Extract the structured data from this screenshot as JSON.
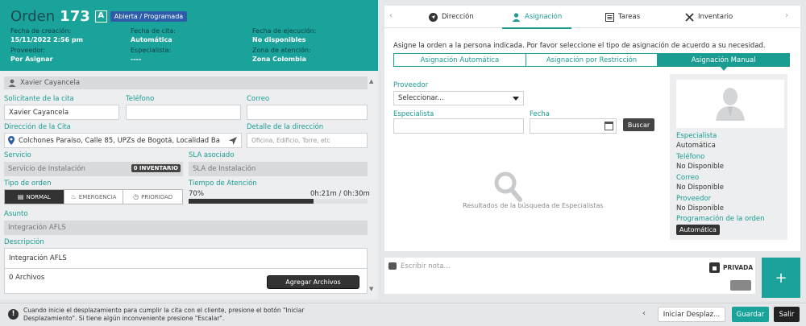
{
  "order": {
    "word": "Orden",
    "number": "173",
    "letter": "A",
    "status": "Abierta / Programada",
    "fields": [
      {
        "label": "Fecha de creación:",
        "value": "15/11/2022 2:56 pm"
      },
      {
        "label": "Fecha de cita:",
        "value": "Automática"
      },
      {
        "label": "Fecha de ejecución:",
        "value": "No disponibles"
      },
      {
        "label": "Proveedor:",
        "value": "Por Asignar"
      },
      {
        "label": "Especialista:",
        "value": "----"
      },
      {
        "label": "Zona de atención:",
        "value": "Zona Colombia"
      }
    ]
  },
  "requester": {
    "name": "Xavier Cayancela",
    "solicitante_label": "Solicitante de la cita",
    "solicitante_value": "Xavier Cayancela",
    "telefono_label": "Teléfono",
    "telefono_value": "",
    "correo_label": "Correo",
    "correo_value": "",
    "direccion_label": "Dirección de la Cita",
    "direccion_value": "Colchones Paraíso, Calle 85, UPZs de Bogotá, Localidad Barrios Un",
    "detalle_label": "Detalle de la dirección",
    "detalle_placeholder": "Oficina, Edificio, Torre, etc"
  },
  "service": {
    "servicio_label": "Servicio",
    "servicio_value": "Servicio de Instalación",
    "inventory_badge": "0 INVENTARIO",
    "sla_label": "SLA asociado",
    "sla_value": "SLA de Instalación",
    "tipo_label": "Tipo de orden",
    "tipos": [
      "NORMAL",
      "EMERGENCIA",
      "PRIORIDAD"
    ],
    "tiempo_label": "Tiempo de Atención",
    "tiempo_percent": "70%",
    "tiempo_fraction": 0.7,
    "tiempo_value": "0h:21m / 0h:30m",
    "asunto_label": "Asunto",
    "asunto_value": "Integración AFLS",
    "descripcion_label": "Descripción",
    "descripcion_value": "Integración AFLS",
    "files_count": "0 Archivos",
    "add_files_label": "Agregar Archivos"
  },
  "tabs": [
    {
      "label": "Dirección",
      "icon": "navigation-icon"
    },
    {
      "label": "Asignación",
      "icon": "person-icon"
    },
    {
      "label": "Tareas",
      "icon": "list-icon"
    },
    {
      "label": "Inventario",
      "icon": "tools-icon"
    }
  ],
  "assignment": {
    "info": "Asigne la orden a la persona indicada. Por favor seleccione el tipo de asignación de acuerdo a su necesidad.",
    "modes": [
      "Asignación Automática",
      "Asignación por Restricción",
      "Asignación Manual"
    ],
    "proveedor_label": "Proveedor",
    "proveedor_selected": "Seleccionar...",
    "especialista_label": "Especialista",
    "fecha_label": "Fecha",
    "search_label": "Buscar",
    "empty_text": "Resultados de la búsqueda de Especialistas"
  },
  "specialist_card": {
    "especialista_label": "Especialista",
    "especialista_value": "Automática",
    "telefono_label": "Teléfono",
    "telefono_value": "No Disponible",
    "correo_label": "Correo",
    "correo_value": "No Disponible",
    "proveedor_label": "Proveedor",
    "proveedor_value": "No Disponible",
    "programacion_label": "Programación de la orden",
    "programacion_value": "Automática"
  },
  "note": {
    "placeholder": "Escribir nota...",
    "private_label": "PRIVADA",
    "add_label": "+"
  },
  "footer": {
    "message": "Cuando inicie el desplazamiento para cumplir la cita con el cliente, presione el botón \"Iniciar Desplazamiento\". Si tiene algún inconveniente presione \"Escalar\".",
    "start_label": "Iniciar Desplaz...",
    "save_label": "Guardar",
    "exit_label": "Salir"
  },
  "colors": {
    "teal": "#1aa39a",
    "status_blue": "#2d5ca8",
    "dark": "#333333"
  }
}
